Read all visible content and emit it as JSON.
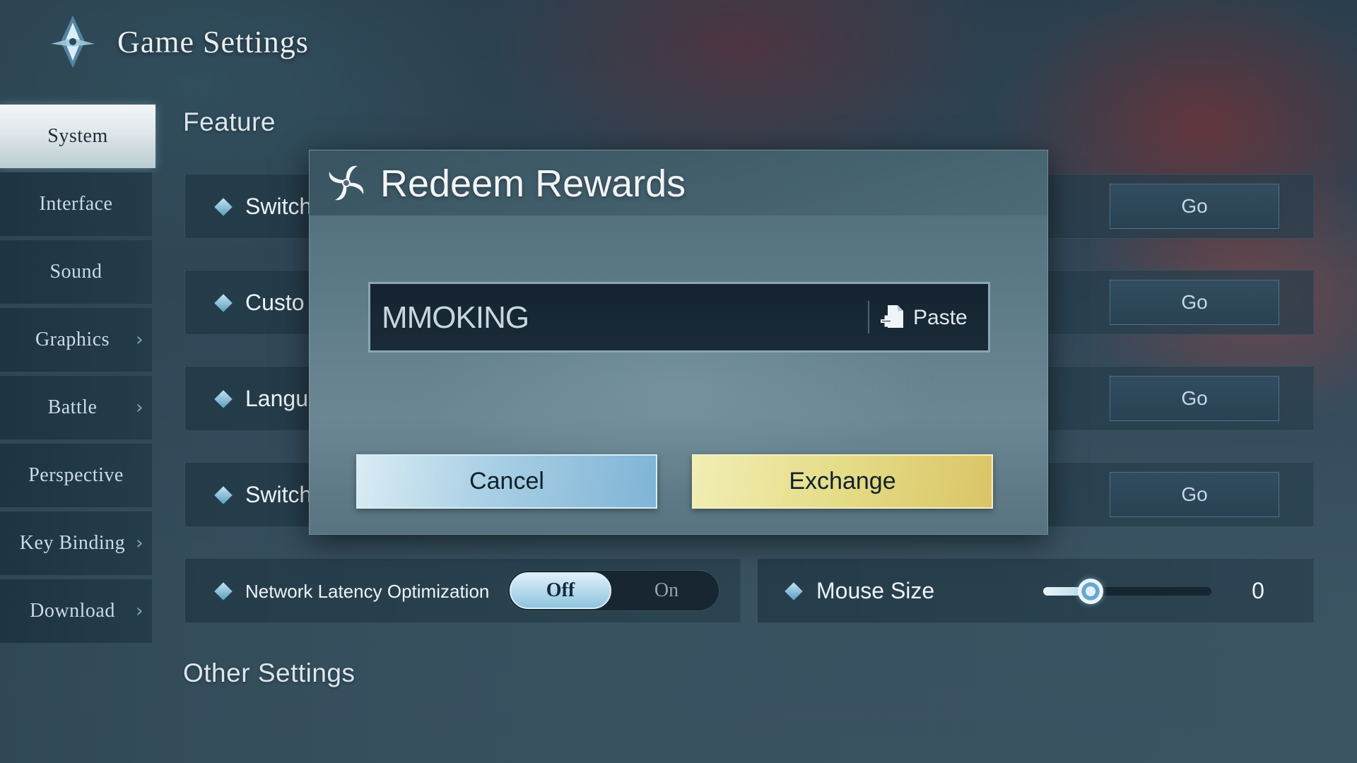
{
  "header": {
    "title": "Game Settings",
    "logo_icon": "compass-star-icon"
  },
  "sidebar": {
    "items": [
      {
        "label": "System",
        "active": true,
        "chevron": false
      },
      {
        "label": "Interface",
        "active": false,
        "chevron": false
      },
      {
        "label": "Sound",
        "active": false,
        "chevron": false
      },
      {
        "label": "Graphics",
        "active": false,
        "chevron": true
      },
      {
        "label": "Battle",
        "active": false,
        "chevron": true
      },
      {
        "label": "Perspective",
        "active": false,
        "chevron": false
      },
      {
        "label": "Key Binding",
        "active": false,
        "chevron": true
      },
      {
        "label": "Download",
        "active": false,
        "chevron": true
      }
    ]
  },
  "main": {
    "feature_title": "Feature",
    "rows": [
      {
        "label": "Switch",
        "button": "Go"
      },
      {
        "label": "Custo",
        "button": "Go"
      },
      {
        "label": "Langu",
        "button": "Go"
      },
      {
        "label": "Switch",
        "button": "Go"
      }
    ],
    "network": {
      "label": "Network Latency Optimization",
      "off_label": "Off",
      "on_label": "On",
      "value": "Off"
    },
    "mouse_size": {
      "label": "Mouse Size",
      "value": "0",
      "fill_fraction": 0.28
    },
    "other_title": "Other Settings"
  },
  "dialog": {
    "title": "Redeem Rewards",
    "icon": "pinwheel-icon",
    "code_value": "MMOKING",
    "paste_label": "Paste",
    "paste_icon": "paste-icon",
    "cancel_label": "Cancel",
    "exchange_label": "Exchange"
  },
  "colors": {
    "accent_blue": "#8fc3df",
    "accent_gold": "#e5dc86",
    "panel": "#21384a"
  }
}
